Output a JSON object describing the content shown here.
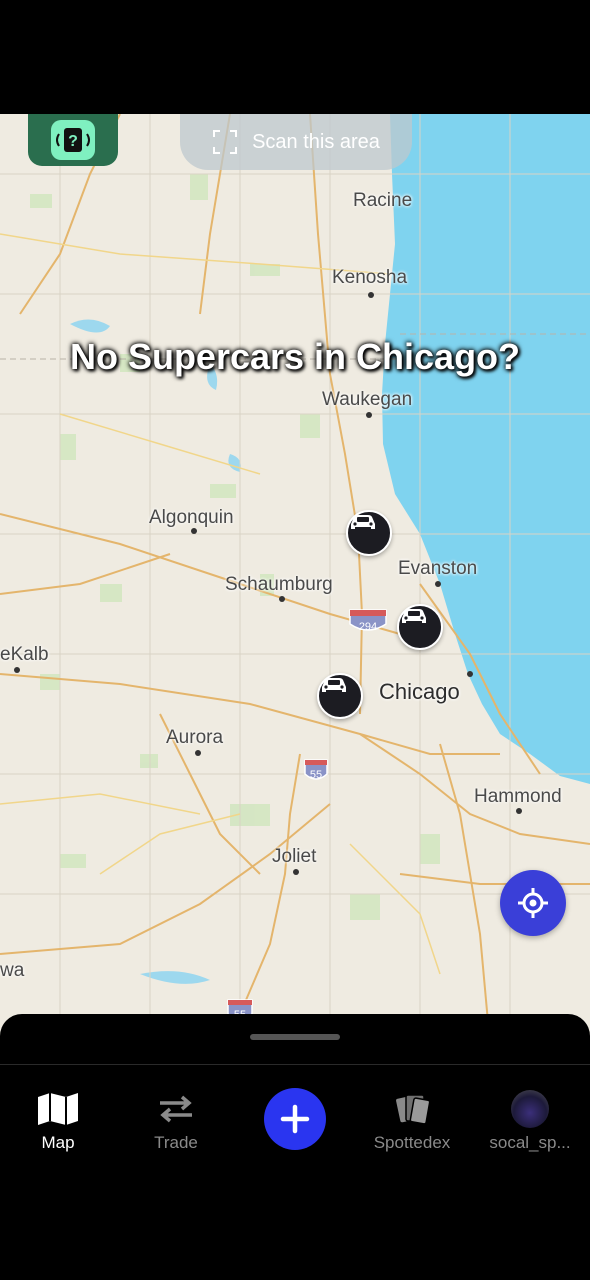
{
  "overlay": {
    "title": "No Supercars in Chicago?"
  },
  "top": {
    "scan_label": "Scan this area",
    "help_icon": "question-speaker-icon"
  },
  "map": {
    "cities": {
      "racine": "Racine",
      "kenosha": "Kenosha",
      "waukegan": "Waukegan",
      "algonquin": "Algonquin",
      "evanston": "Evanston",
      "schaumburg": "Schaumburg",
      "dekalb": "eKalb",
      "chicago": "Chicago",
      "aurora": "Aurora",
      "hammond": "Hammond",
      "joliet": "Joliet",
      "ottawa": "wa"
    },
    "shields": {
      "i294": "294",
      "i55a": "55",
      "i55b": "55"
    },
    "water_color": "#7fd3ef",
    "land_color": "#efebe1"
  },
  "tabs": [
    {
      "label": "Map",
      "icon": "map-icon"
    },
    {
      "label": "Trade",
      "icon": "swap-arrows-icon"
    },
    {
      "label": "",
      "icon": "plus-icon"
    },
    {
      "label": "Spottedex",
      "icon": "cards-icon"
    },
    {
      "label": "socal_sp...",
      "icon": "avatar"
    }
  ],
  "accent": "#2a35f0"
}
